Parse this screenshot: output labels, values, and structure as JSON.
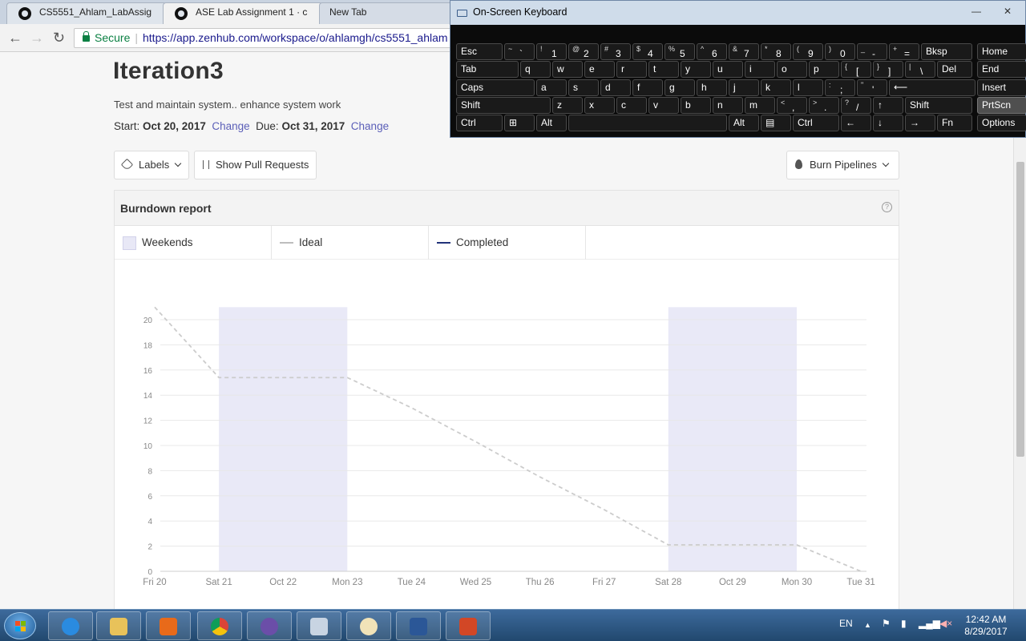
{
  "browser": {
    "tabs": [
      {
        "label": "CS5551_Ahlam_LabAssig",
        "active": false
      },
      {
        "label": "ASE Lab Assignment 1 · c",
        "active": true
      },
      {
        "label": "New Tab",
        "active": false
      }
    ],
    "secure_label": "Secure",
    "url": "https://app.zenhub.com/workspace/o/ahlamgh/cs5551_ahlam"
  },
  "iteration": {
    "title": "Iteration3",
    "description": "Test and maintain system.. enhance system work",
    "start_label": "Start:",
    "start_date": "Oct 20, 2017",
    "start_change": "Change",
    "due_label": "Due:",
    "due_date": "Oct 31, 2017",
    "due_change": "Change"
  },
  "filters": {
    "labels_button": "Labels",
    "pull_requests_button": "Show Pull Requests",
    "burn_pipelines_button": "Burn Pipelines"
  },
  "report": {
    "title": "Burndown report",
    "help": "?",
    "legend": {
      "weekends": "Weekends",
      "ideal": "Ideal",
      "completed": "Completed"
    }
  },
  "chart_data": {
    "type": "line",
    "title": "",
    "xlabel": "",
    "ylabel": "",
    "categories": [
      "Fri 20",
      "Sat 21",
      "Oct 22",
      "Mon 23",
      "Tue 24",
      "Wed 25",
      "Thu 26",
      "Fri 27",
      "Sat 28",
      "Oct 29",
      "Mon 30",
      "Tue 31"
    ],
    "yticks": [
      0,
      2,
      4,
      6,
      8,
      10,
      12,
      14,
      16,
      18,
      20
    ],
    "ylim": [
      0,
      21
    ],
    "grid": true,
    "weekend_bands": [
      [
        "Sat 21",
        "Mon 23"
      ],
      [
        "Sat 28",
        "Mon 30"
      ]
    ],
    "series": [
      {
        "name": "Ideal",
        "color": "#cccccc",
        "style": "dashed",
        "points": [
          [
            "Fri 20",
            21
          ],
          [
            "Sat 21",
            15.4
          ],
          [
            "Oct 22",
            15.4
          ],
          [
            "Mon 23",
            15.4
          ],
          [
            "Tue 24",
            13.0
          ],
          [
            "Wed 25",
            10.3
          ],
          [
            "Thu 26",
            7.5
          ],
          [
            "Fri 27",
            4.9
          ],
          [
            "Sat 28",
            2.1
          ],
          [
            "Oct 29",
            2.1
          ],
          [
            "Mon 30",
            2.1
          ],
          [
            "Tue 31",
            0
          ]
        ]
      },
      {
        "name": "Completed",
        "color": "#22337a",
        "style": "solid",
        "points": []
      }
    ],
    "weekend_color": "#e9e9f7"
  },
  "keyboard": {
    "title": "On-Screen Keyboard",
    "rows": [
      [
        {
          "l": "Esc"
        },
        {
          "l": "~",
          "s": "`"
        },
        {
          "l": "!",
          "s": "1"
        },
        {
          "l": "@",
          "s": "2"
        },
        {
          "l": "#",
          "s": "3"
        },
        {
          "l": "$",
          "s": "4"
        },
        {
          "l": "%",
          "s": "5"
        },
        {
          "l": "^",
          "s": "6"
        },
        {
          "l": "&",
          "s": "7"
        },
        {
          "l": "*",
          "s": "8"
        },
        {
          "l": "(",
          "s": "9"
        },
        {
          "l": ")",
          "s": "0"
        },
        {
          "l": "_",
          "s": "-"
        },
        {
          "l": "+",
          "s": "="
        },
        {
          "l": "Bksp"
        },
        {
          "l": "Home"
        }
      ],
      [
        {
          "l": "Tab"
        },
        {
          "l": "q"
        },
        {
          "l": "w"
        },
        {
          "l": "e"
        },
        {
          "l": "r"
        },
        {
          "l": "t"
        },
        {
          "l": "y"
        },
        {
          "l": "u"
        },
        {
          "l": "i"
        },
        {
          "l": "o"
        },
        {
          "l": "p"
        },
        {
          "l": "{",
          "s": "["
        },
        {
          "l": "}",
          "s": "]"
        },
        {
          "l": "|",
          "s": "\\"
        },
        {
          "l": "Del"
        },
        {
          "l": "End"
        }
      ],
      [
        {
          "l": "Caps"
        },
        {
          "l": "a"
        },
        {
          "l": "s"
        },
        {
          "l": "d"
        },
        {
          "l": "f"
        },
        {
          "l": "g"
        },
        {
          "l": "h"
        },
        {
          "l": "j"
        },
        {
          "l": "k"
        },
        {
          "l": "l"
        },
        {
          "l": ":",
          "s": ";"
        },
        {
          "l": "\"",
          "s": "'"
        },
        {
          "l": "⟵"
        },
        {
          "l": "Insert"
        }
      ],
      [
        {
          "l": "Shift"
        },
        {
          "l": "z"
        },
        {
          "l": "x"
        },
        {
          "l": "c"
        },
        {
          "l": "v"
        },
        {
          "l": "b"
        },
        {
          "l": "n"
        },
        {
          "l": "m"
        },
        {
          "l": "<",
          "s": ","
        },
        {
          "l": ">",
          "s": "."
        },
        {
          "l": "?",
          "s": "/"
        },
        {
          "l": "↑"
        },
        {
          "l": "Shift"
        },
        {
          "l": "PrtScn"
        }
      ],
      [
        {
          "l": "Ctrl"
        },
        {
          "l": "⊞"
        },
        {
          "l": "Alt"
        },
        {
          "l": ""
        },
        {
          "l": "Alt"
        },
        {
          "l": "▤"
        },
        {
          "l": "Ctrl"
        },
        {
          "l": "←"
        },
        {
          "l": "↓"
        },
        {
          "l": "→"
        },
        {
          "l": "Fn"
        },
        {
          "l": "Options"
        }
      ]
    ]
  },
  "taskbar": {
    "language": "EN",
    "time": "12:42 AM",
    "date": "8/29/2017",
    "apps": [
      "internet-explorer",
      "file-explorer",
      "media-player",
      "chrome",
      "github-desktop",
      "on-screen-keyboard",
      "paint",
      "word",
      "powerpoint"
    ]
  }
}
